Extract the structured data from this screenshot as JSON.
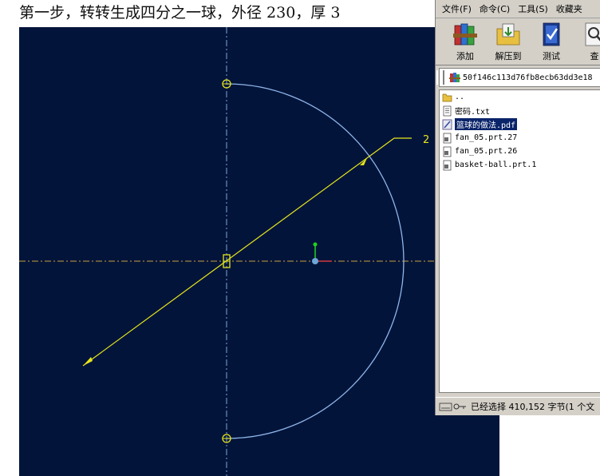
{
  "caption": "第一步，转转生成四分之一球，外径 230，厚 3",
  "cad": {
    "dimension_label": "2"
  },
  "winrar": {
    "menu": [
      "文件(F)",
      "命令(C)",
      "工具(S)",
      "收藏夹"
    ],
    "toolbar": [
      {
        "label": "添加",
        "icon": "books-archive-icon"
      },
      {
        "label": "解压到",
        "icon": "extract-folder-icon"
      },
      {
        "label": "测试",
        "icon": "test-archive-icon"
      },
      {
        "label": "查",
        "icon": "view-icon"
      }
    ],
    "path": "50f146c113d76fb8ecb63dd3e18",
    "files": [
      {
        "name": "..",
        "icon": "folder-up-icon"
      },
      {
        "name": "密码.txt",
        "icon": "text-file-icon"
      },
      {
        "name": "篮球的做法.pdf",
        "icon": "pdf-file-icon",
        "selected": true
      },
      {
        "name": "fan_05.prt.27",
        "icon": "generic-file-icon"
      },
      {
        "name": "fan_05.prt.26",
        "icon": "generic-file-icon"
      },
      {
        "name": "basket-ball.prt.1",
        "icon": "generic-file-icon"
      }
    ],
    "status": "已经选择 410,152 字节(1 个文"
  },
  "colors": {
    "viewport_bg": "#03143a",
    "arc": "#8fb6ea",
    "centerline": "#c8a040",
    "sketch": "#e6e61a",
    "selection": "#0a246a"
  }
}
